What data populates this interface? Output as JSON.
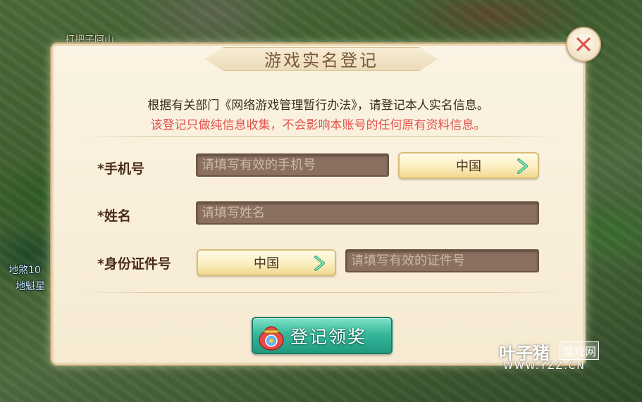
{
  "background": {
    "npc_labels": [
      "打把子阿山",
      "地煞10",
      "地魁星"
    ]
  },
  "dialog": {
    "title": "游戏实名登记",
    "close_icon": "close-x-icon",
    "notice_line_1": "根据有关部门《网络游戏管理暂行办法》，请登记本人实名信息。",
    "notice_line_2": "该登记只做纯信息收集，不会影响本账号的任何原有资料信息。",
    "fields": {
      "phone": {
        "label": "*手机号",
        "placeholder": "请填写有效的手机号",
        "region_value": "中国"
      },
      "name": {
        "label": "*姓名",
        "placeholder": "请填写姓名"
      },
      "id": {
        "label": "*身份证件号",
        "region_value": "中国",
        "placeholder": "请填写有效的证件号"
      }
    },
    "submit_label": "登记领奖"
  },
  "watermark": {
    "brand": "叶子猪",
    "tag": "游戏网",
    "url": "WWW.YZZ.CN"
  },
  "colors": {
    "notice_warning": "#e4514b",
    "submit_button": "#36b79b",
    "input_background": "#8a7060"
  }
}
